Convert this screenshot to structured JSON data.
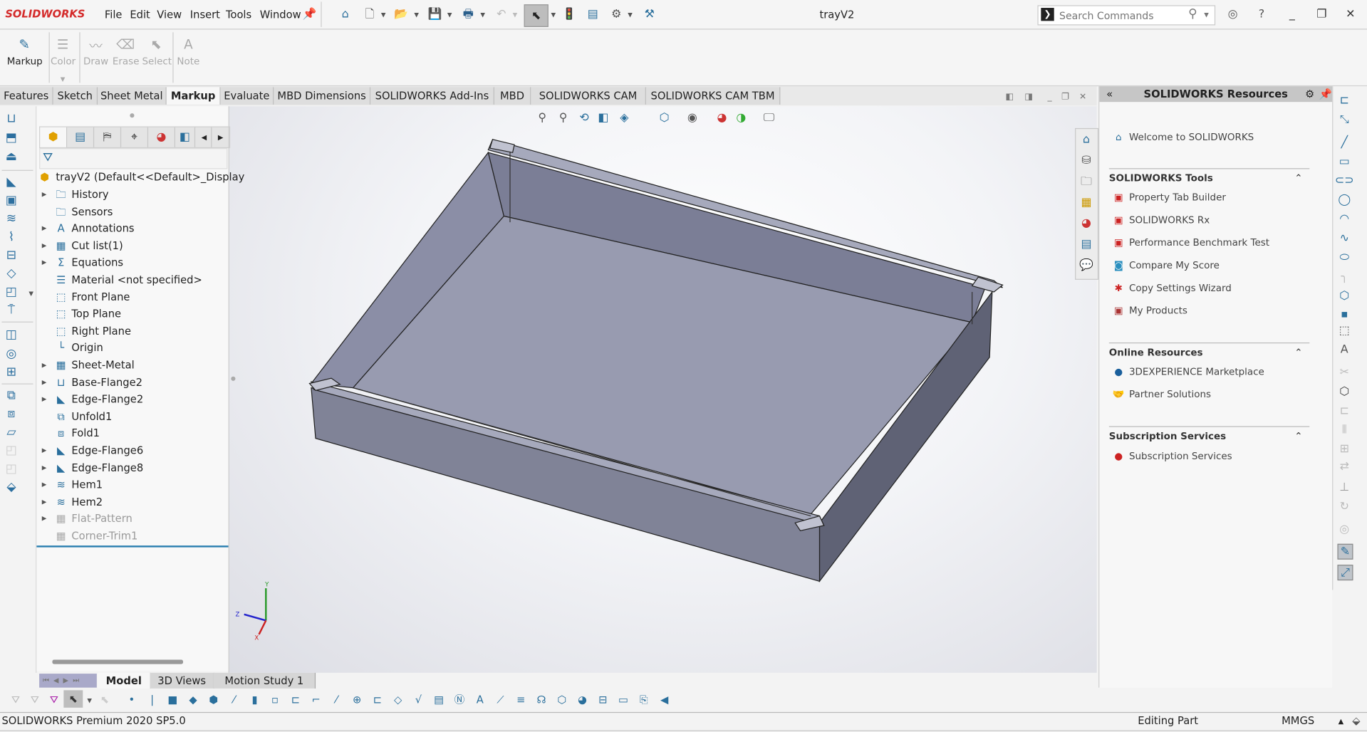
{
  "app": {
    "logo": "SOLIDWORKS",
    "document_title": "trayV2"
  },
  "menu": [
    "File",
    "Edit",
    "View",
    "Insert",
    "Tools",
    "Window"
  ],
  "search": {
    "placeholder": "Search Commands"
  },
  "ribbon": {
    "markup": "Markup",
    "color": "Color",
    "draw": "Draw",
    "erase": "Erase",
    "select": "Select",
    "note": "Note"
  },
  "tabs": [
    {
      "label": "Features"
    },
    {
      "label": "Sketch"
    },
    {
      "label": "Sheet Metal"
    },
    {
      "label": "Markup",
      "active": true
    },
    {
      "label": "Evaluate"
    },
    {
      "label": "MBD Dimensions"
    },
    {
      "label": "SOLIDWORKS Add-Ins"
    },
    {
      "label": "MBD"
    },
    {
      "label": "SOLIDWORKS CAM"
    },
    {
      "label": "SOLIDWORKS CAM TBM"
    }
  ],
  "tree": {
    "root": "trayV2  (Default<<Default>_Display",
    "items": [
      {
        "label": "History",
        "expandable": true,
        "icon": "history-folder-icon"
      },
      {
        "label": "Sensors",
        "expandable": false,
        "icon": "sensors-folder-icon"
      },
      {
        "label": "Annotations",
        "expandable": true,
        "icon": "annotations-folder-icon"
      },
      {
        "label": "Cut list(1)",
        "expandable": true,
        "icon": "cut-list-icon"
      },
      {
        "label": "Equations",
        "expandable": true,
        "icon": "equations-folder-icon"
      },
      {
        "label": "Material <not specified>",
        "expandable": false,
        "icon": "material-icon"
      },
      {
        "label": "Front Plane",
        "expandable": false,
        "icon": "plane-icon"
      },
      {
        "label": "Top Plane",
        "expandable": false,
        "icon": "plane-icon"
      },
      {
        "label": "Right Plane",
        "expandable": false,
        "icon": "plane-icon"
      },
      {
        "label": "Origin",
        "expandable": false,
        "icon": "origin-icon"
      },
      {
        "label": "Sheet-Metal",
        "expandable": true,
        "icon": "sheet-metal-icon"
      },
      {
        "label": "Base-Flange2",
        "expandable": true,
        "icon": "base-flange-icon"
      },
      {
        "label": "Edge-Flange2",
        "expandable": true,
        "icon": "edge-flange-icon"
      },
      {
        "label": "Unfold1",
        "expandable": false,
        "icon": "unfold-icon"
      },
      {
        "label": "Fold1",
        "expandable": false,
        "icon": "fold-icon"
      },
      {
        "label": "Edge-Flange6",
        "expandable": true,
        "icon": "edge-flange-icon"
      },
      {
        "label": "Edge-Flange8",
        "expandable": true,
        "icon": "edge-flange-icon"
      },
      {
        "label": "Hem1",
        "expandable": true,
        "icon": "hem-icon"
      },
      {
        "label": "Hem2",
        "expandable": true,
        "icon": "hem-icon"
      },
      {
        "label": "Flat-Pattern",
        "expandable": true,
        "suppressed": true,
        "icon": "flat-pattern-icon"
      },
      {
        "label": "Corner-Trim1",
        "expandable": false,
        "suppressed": true,
        "icon": "corner-trim-icon"
      }
    ]
  },
  "resources": {
    "title": "SOLIDWORKS Resources",
    "welcome": "Welcome to SOLIDWORKS",
    "tools_title": "SOLIDWORKS Tools",
    "tools": [
      "Property Tab Builder",
      "SOLIDWORKS Rx",
      "Performance Benchmark Test",
      "Compare My Score",
      "Copy Settings Wizard",
      "My Products"
    ],
    "online_title": "Online Resources",
    "online": [
      "3DEXPERIENCE Marketplace",
      "Partner Solutions"
    ],
    "subscription_title": "Subscription Services",
    "subscription": [
      "Subscription Services"
    ]
  },
  "bottom_tabs": [
    {
      "label": "Model",
      "active": true
    },
    {
      "label": "3D Views"
    },
    {
      "label": "Motion Study 1"
    }
  ],
  "triad": {
    "x": "X",
    "y": "Y",
    "z": "Z"
  },
  "status": {
    "version": "SOLIDWORKS Premium 2020 SP5.0",
    "mode": "Editing Part",
    "units": "MMGS"
  },
  "colors": {
    "accent": "#2a6f9c",
    "logo_red": "#d42a2a",
    "model_face": "#989bb0"
  }
}
